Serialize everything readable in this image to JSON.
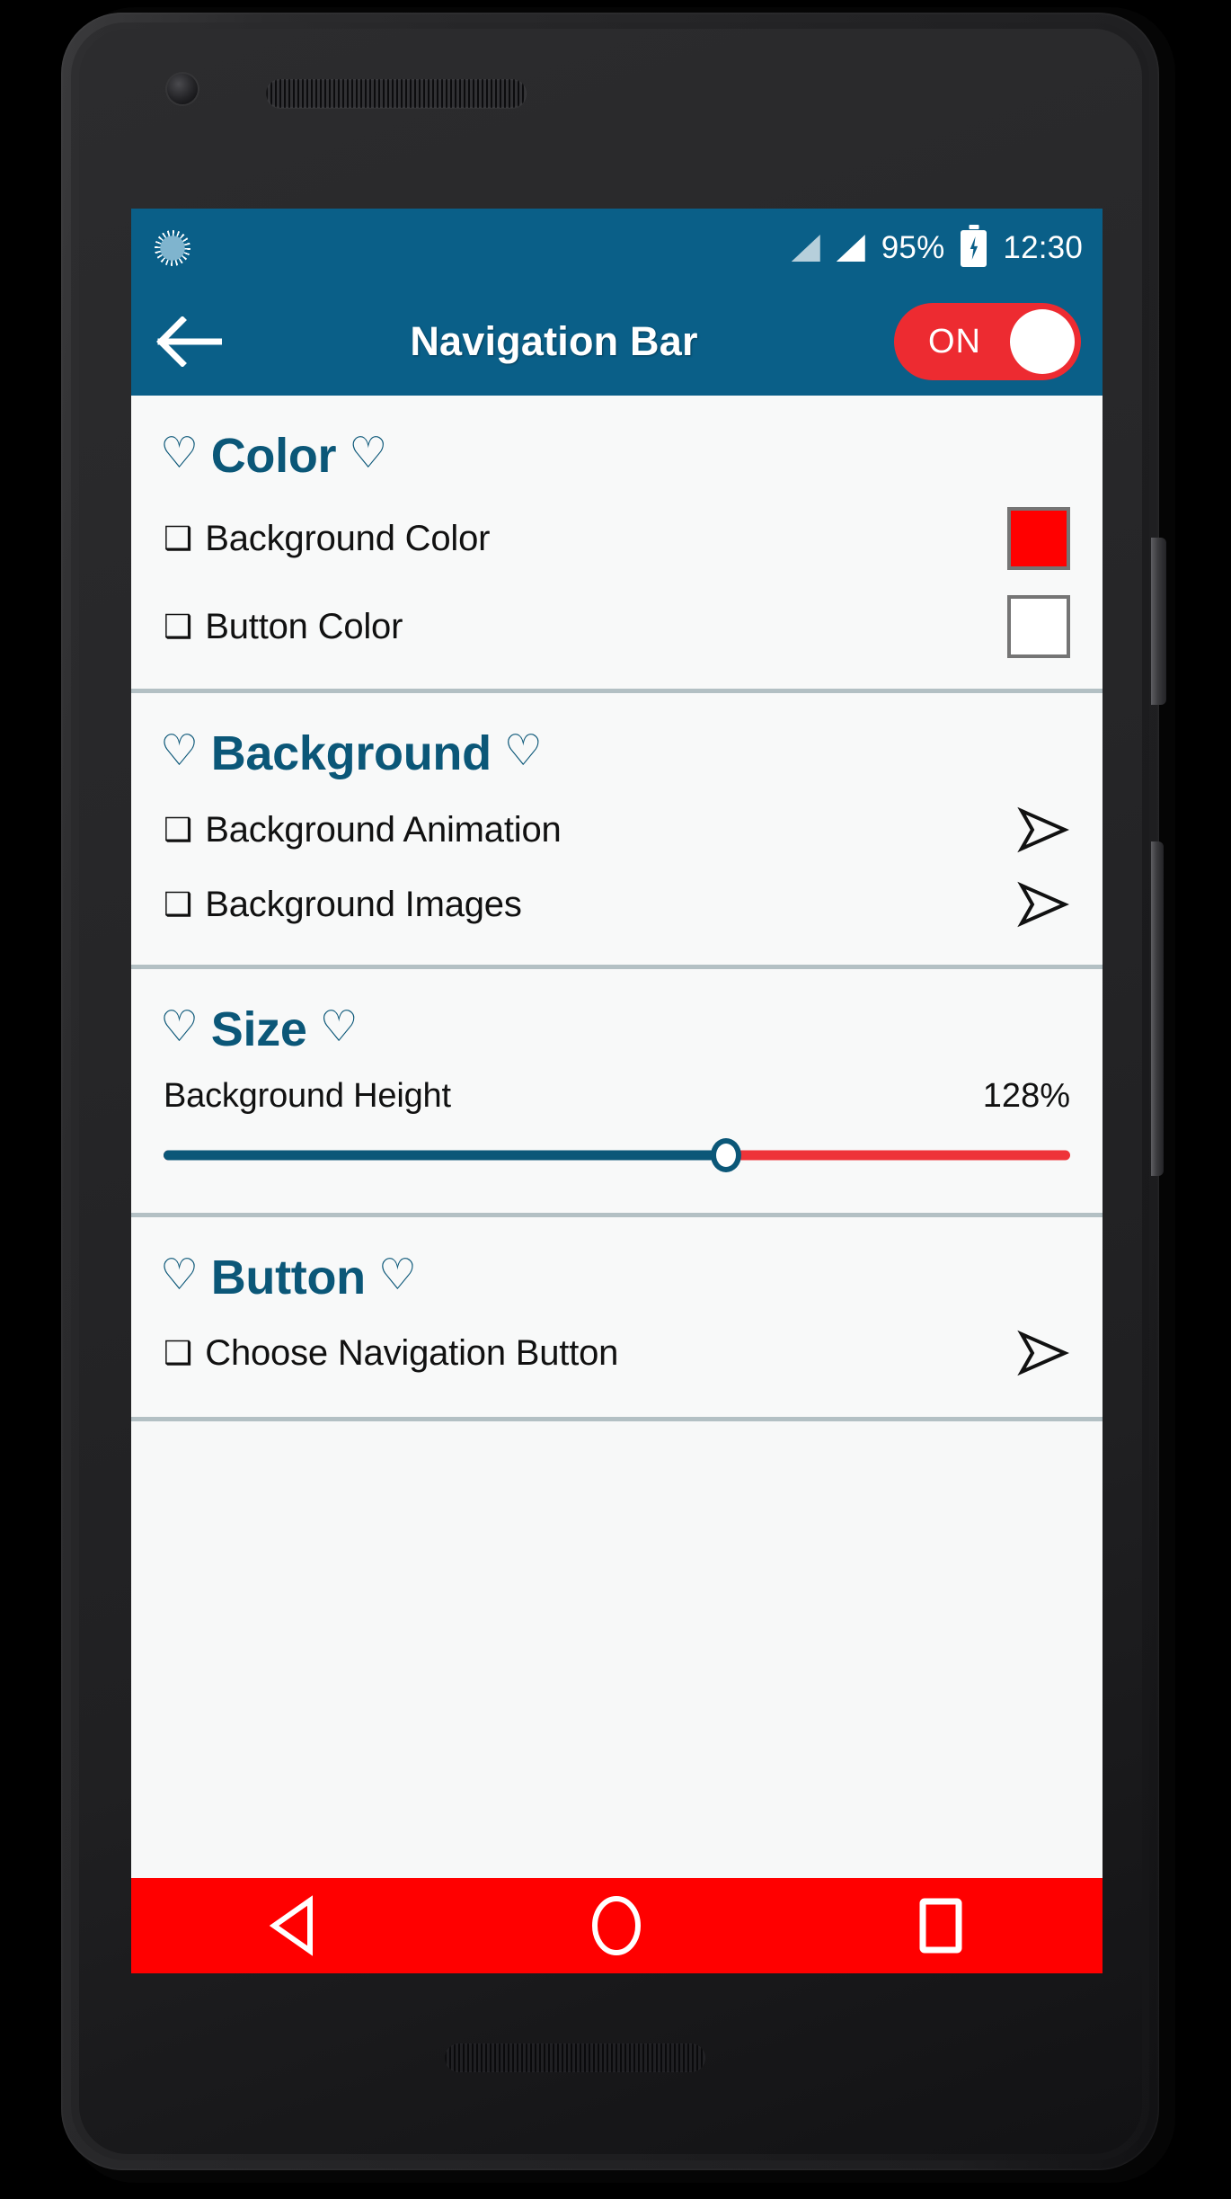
{
  "status_bar": {
    "spinner_icon": "spinner-icon",
    "signal_icon_1": "signal-bars-icon",
    "signal_icon_2": "signal-bars-icon",
    "battery_percent": "95%",
    "battery_icon": "battery-charging-icon",
    "time": "12:30"
  },
  "app_bar": {
    "back_icon": "back-arrow-icon",
    "title": "Navigation Bar",
    "toggle_label": "ON",
    "toggle_state": "on"
  },
  "colors": {
    "app_bar_blue": "#0A5F88",
    "header_teal": "#0B5778",
    "accent_red": "#ED2B31",
    "nav_bar_red": "#FF0000",
    "screen_bg": "#F8F9F9",
    "divider": "#B3C0C4"
  },
  "sections": [
    {
      "id": "color",
      "heart_left": "♡",
      "heart_right": "♡",
      "title": "Color",
      "rows": [
        {
          "bullet": "❑",
          "label": "Background Color",
          "control": "swatch",
          "swatch_color": "#FF0000"
        },
        {
          "bullet": "❑",
          "label": "Button Color",
          "control": "swatch",
          "swatch_color": "#FFFFFF"
        }
      ]
    },
    {
      "id": "background",
      "heart_left": "♡",
      "heart_right": "♡",
      "title": "Background",
      "rows": [
        {
          "bullet": "❑",
          "label": "Background Animation",
          "control": "arrow",
          "arrow_icon": "play-arrow-outline-icon"
        },
        {
          "bullet": "❑",
          "label": "Background Images",
          "control": "arrow",
          "arrow_icon": "play-arrow-outline-icon"
        }
      ]
    },
    {
      "id": "size",
      "heart_left": "♡",
      "heart_right": "♡",
      "title": "Size",
      "slider": {
        "label": "Background Height",
        "value_text": "128%",
        "fill_percent": 62
      }
    },
    {
      "id": "button",
      "heart_left": "♡",
      "heart_right": "♡",
      "title": "Button",
      "rows": [
        {
          "bullet": "❑",
          "label": "Choose Navigation Button",
          "control": "arrow",
          "arrow_icon": "play-arrow-outline-icon"
        }
      ]
    }
  ],
  "nav_bar": {
    "back_icon": "nav-back-triangle-icon",
    "home_icon": "nav-home-circle-icon",
    "recents_icon": "nav-recents-square-icon"
  }
}
